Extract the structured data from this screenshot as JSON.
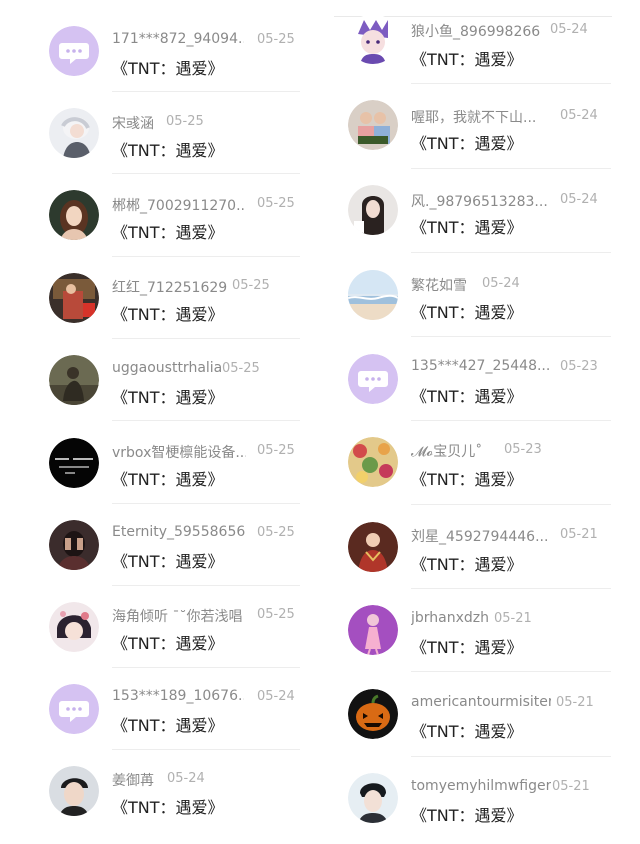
{
  "colors": {
    "default_avatar": "#d5c2f2",
    "divider": "#ededed",
    "name_text": "#8a8a8a",
    "date_text": "#b0b0b0",
    "title_text": "#222222"
  },
  "left_column": [
    {
      "username": "171***872_94094...",
      "date": "05-25",
      "title": "《TNT：遇爱》",
      "avatar": "default-chat-icon"
    },
    {
      "username": "宋彧涵",
      "date": "05-25",
      "title": "《TNT：遇爱》",
      "avatar": "photo"
    },
    {
      "username": "郴郴_7002911270...",
      "date": "05-25",
      "title": "《TNT：遇爱》",
      "avatar": "photo"
    },
    {
      "username": "红红_712251629",
      "date": "05-25",
      "title": "《TNT：遇爱》",
      "avatar": "photo"
    },
    {
      "username": "uggaousttrhalia",
      "date": "05-25",
      "title": "《TNT：遇爱》",
      "avatar": "photo"
    },
    {
      "username": "vrbox智梗檩能设备...",
      "date": "05-25",
      "title": "《TNT：遇爱》",
      "avatar": "photo"
    },
    {
      "username": "Eternity_59558656...",
      "date": "05-25",
      "title": "《TNT：遇爱》",
      "avatar": "photo"
    },
    {
      "username": "海角倾听 ˉ˘你若浅唱",
      "date": "05-25",
      "title": "《TNT：遇爱》",
      "avatar": "photo"
    },
    {
      "username": "153***189_10676...",
      "date": "05-24",
      "title": "《TNT：遇爱》",
      "avatar": "default-chat-icon"
    },
    {
      "username": "姜御苒",
      "date": "05-24",
      "title": "《TNT：遇爱》",
      "avatar": "photo"
    }
  ],
  "right_column": [
    {
      "username": "狼小鱼_896998266",
      "date": "05-24",
      "title": "《TNT：遇爱》",
      "avatar": "photo"
    },
    {
      "username": "喔耶，我就不下山...",
      "date": "05-24",
      "title": "《TNT：遇爱》",
      "avatar": "photo"
    },
    {
      "username": "风._98796513283...",
      "date": "05-24",
      "title": "《TNT：遇爱》",
      "avatar": "photo"
    },
    {
      "username": "繁花如雪",
      "date": "05-24",
      "title": "《TNT：遇爱》",
      "avatar": "photo"
    },
    {
      "username": "135***427_25448...",
      "date": "05-23",
      "title": "《TNT：遇爱》",
      "avatar": "default-chat-icon"
    },
    {
      "username": "𝓜𝓸宝贝儿˚",
      "date": "05-23",
      "title": "《TNT：遇爱》",
      "avatar": "photo"
    },
    {
      "username": "刘星_4592794446...",
      "date": "05-21",
      "title": "《TNT：遇爱》",
      "avatar": "photo"
    },
    {
      "username": "jbrhanxdzh",
      "date": "05-21",
      "title": "《TNT：遇爱》",
      "avatar": "photo"
    },
    {
      "username": "americantourmisiter",
      "date": "05-21",
      "title": "《TNT：遇爱》",
      "avatar": "photo"
    },
    {
      "username": "tomyemyhilmwfiger",
      "date": "05-21",
      "title": "《TNT：遇爱》",
      "avatar": "photo"
    }
  ]
}
